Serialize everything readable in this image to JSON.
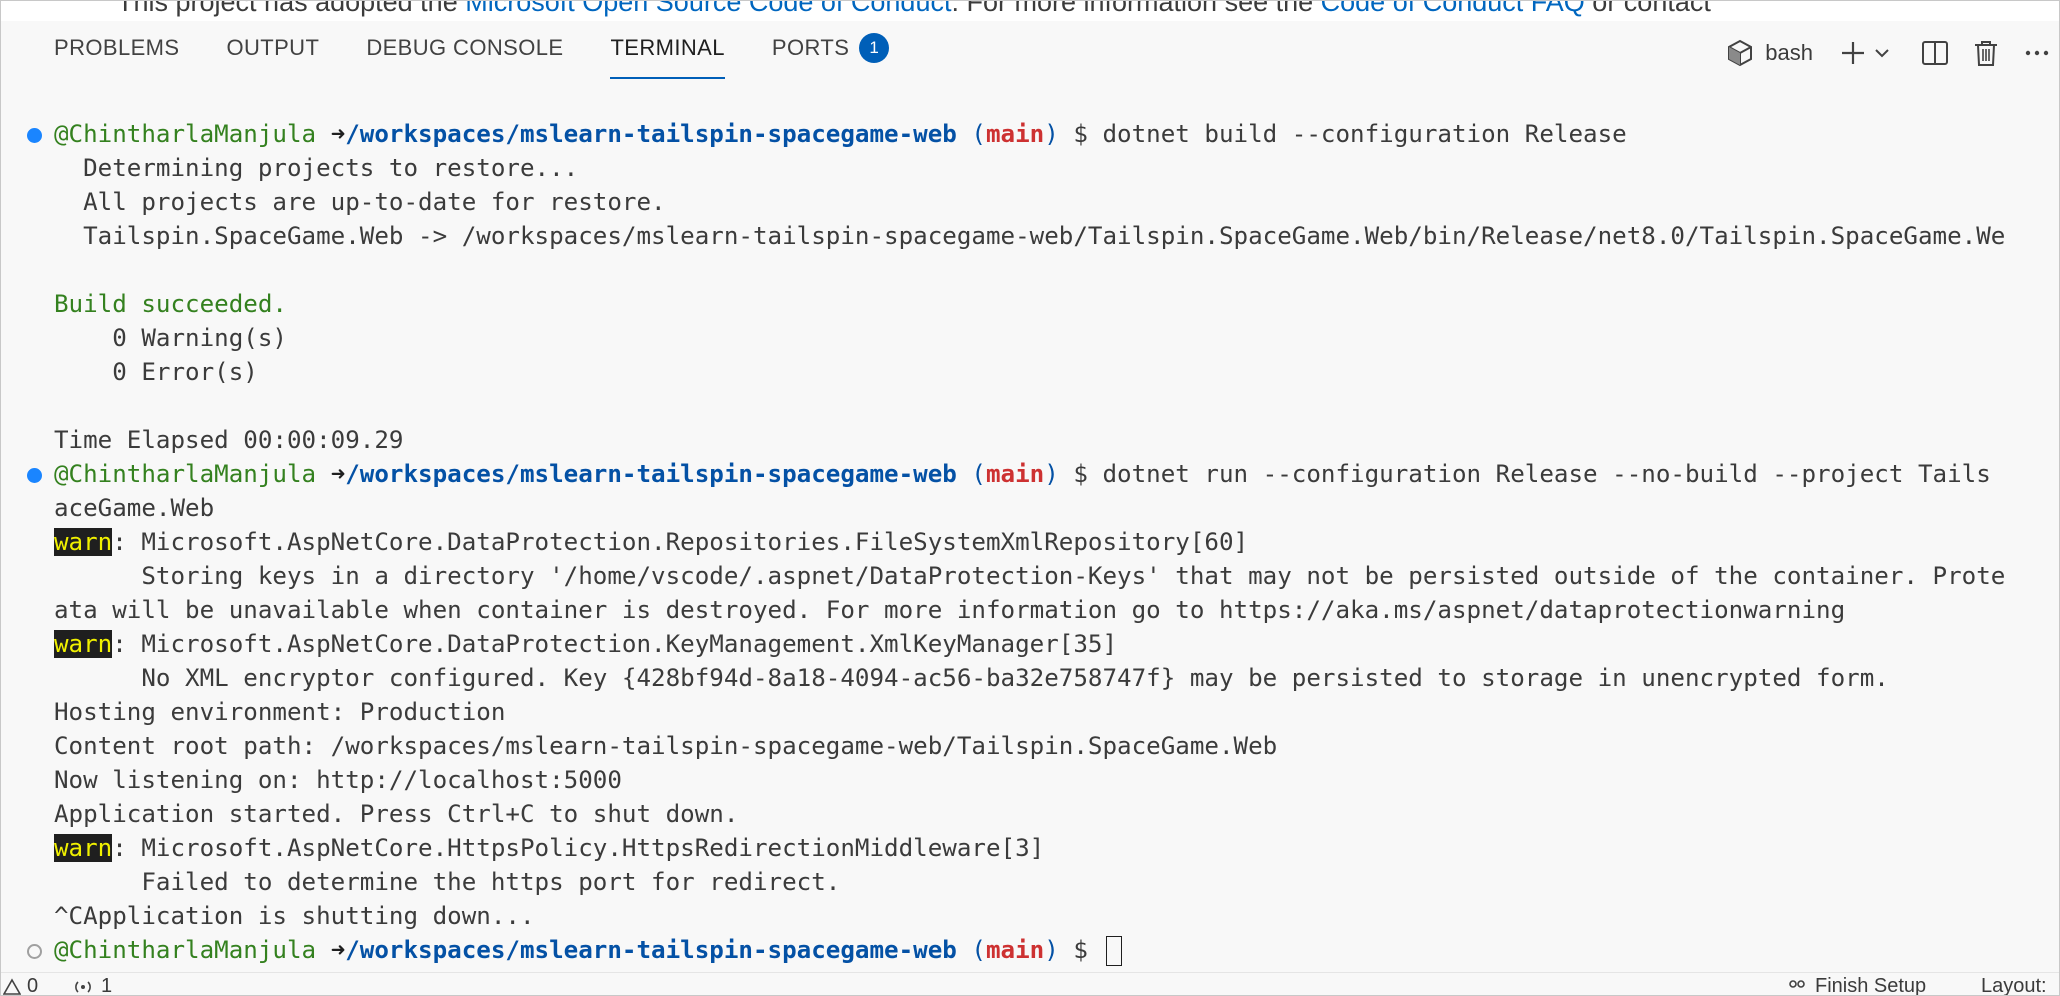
{
  "top_text": {
    "before": "This project has adopted the ",
    "link1": "Microsoft Open Source Code of Conduct",
    "middle": ". For more information see the ",
    "link2": "Code of Conduct FAQ",
    "after": " or contact"
  },
  "tabs": [
    {
      "label": "PROBLEMS"
    },
    {
      "label": "OUTPUT"
    },
    {
      "label": "DEBUG CONSOLE"
    },
    {
      "label": "TERMINAL"
    },
    {
      "label": "PORTS",
      "badge": "1"
    }
  ],
  "terminal_shell": "bash",
  "prompt": {
    "user": "@ChintharlaManjula",
    "arrow": "➜",
    "path": "/workspaces/mslearn-tailspin-spacegame-web",
    "branch_open": "(",
    "branch": "main",
    "branch_close": ")",
    "dollar": "$"
  },
  "terminal": {
    "cmd1": "dotnet build --configuration Release",
    "l2": "  Determining projects to restore...",
    "l3": "  All projects are up-to-date for restore.",
    "l4": "  Tailspin.SpaceGame.Web -> /workspaces/mslearn-tailspin-spacegame-web/Tailspin.SpaceGame.Web/bin/Release/net8.0/Tailspin.SpaceGame.We",
    "build_ok": "Build succeeded.",
    "warnings": "    0 Warning(s)",
    "errors": "    0 Error(s)",
    "elapsed": "Time Elapsed 00:00:09.29",
    "cmd2": "dotnet run --configuration Release --no-build --project Tails",
    "cmd2_wrap": "aceGame.Web",
    "warn_tag": "warn",
    "w1": ": Microsoft.AspNetCore.DataProtection.Repositories.FileSystemXmlRepository[60]",
    "w1a": "      Storing keys in a directory '/home/vscode/.aspnet/DataProtection-Keys' that may not be persisted outside of the container. Prote",
    "w1b": "ata will be unavailable when container is destroyed. For more information go to https://aka.ms/aspnet/dataprotectionwarning",
    "w2": ": Microsoft.AspNetCore.DataProtection.KeyManagement.XmlKeyManager[35]",
    "w2a": "      No XML encryptor configured. Key {428bf94d-8a18-4094-ac56-ba32e758747f} may be persisted to storage in unencrypted form.",
    "env": "Hosting environment: Production",
    "root": "Content root path: /workspaces/mslearn-tailspin-spacegame-web/Tailspin.SpaceGame.Web",
    "listen": "Now listening on: http://localhost:5000",
    "started": "Application started. Press Ctrl+C to shut down.",
    "w3": ": Microsoft.AspNetCore.HttpsPolicy.HttpsRedirectionMiddleware[3]",
    "w3a": "      Failed to determine the https port for redirect.",
    "shutdown": "^CApplication is shutting down..."
  },
  "status": {
    "problems": "0",
    "ports": "1",
    "finish_setup": "Finish Setup",
    "layout": "Layout:"
  },
  "icons": {
    "bash": "terminal-cube-icon",
    "add": "plus-icon",
    "dropdown": "chevron-down-icon",
    "split": "split-terminal-icon",
    "kill": "trash-icon",
    "more": "ellipsis-icon"
  }
}
